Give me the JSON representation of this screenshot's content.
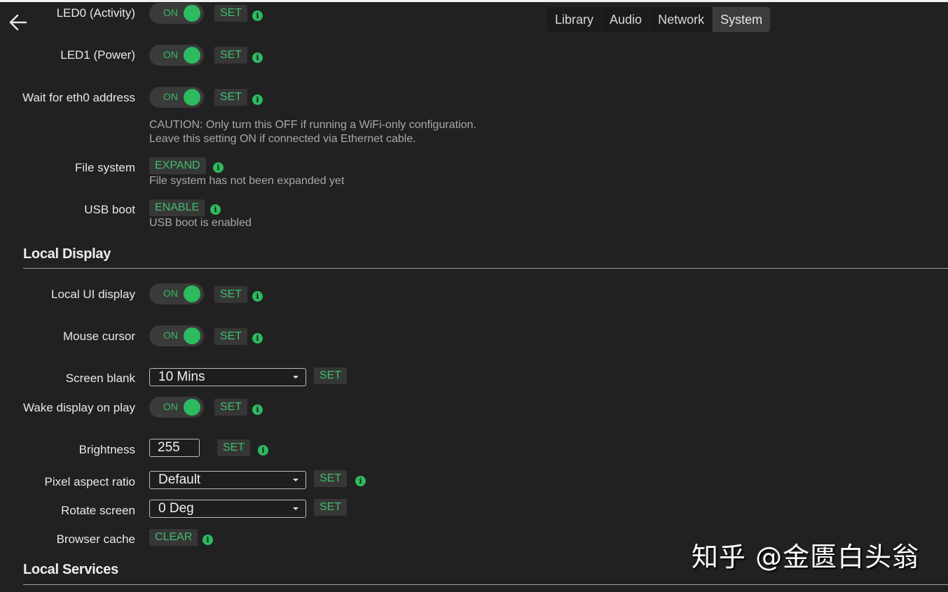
{
  "nav": {
    "back_icon": "arrow-left-icon",
    "tabs": [
      {
        "label": "Library",
        "active": false
      },
      {
        "label": "Audio",
        "active": false
      },
      {
        "label": "Network",
        "active": false
      },
      {
        "label": "System",
        "active": true
      }
    ]
  },
  "colors": {
    "background": "#212121",
    "accent": "#2dbb5f",
    "button_bg": "#363636",
    "toggle_bg": "#3a3a3a"
  },
  "system": {
    "led0": {
      "label": "LED0 (Activity)",
      "toggle": "ON",
      "button": "SET",
      "info_icon": "info-icon"
    },
    "led1": {
      "label": "LED1 (Power)",
      "toggle": "ON",
      "button": "SET"
    },
    "wait_eth0": {
      "label": "Wait for eth0 address",
      "toggle": "ON",
      "button": "SET",
      "help_line1": "CAUTION: Only turn this OFF if running a WiFi-only configuration.",
      "help_line2": "Leave this setting ON if connected via Ethernet cable."
    },
    "file_system": {
      "label": "File system",
      "button": "EXPAND",
      "help": "File system has not been expanded yet"
    },
    "usb_boot": {
      "label": "USB boot",
      "button": "ENABLE",
      "help": "USB boot is enabled"
    }
  },
  "local_display": {
    "title": "Local Display",
    "local_ui": {
      "label": "Local UI display",
      "toggle": "ON",
      "button": "SET"
    },
    "mouse_cursor": {
      "label": "Mouse cursor",
      "toggle": "ON",
      "button": "SET"
    },
    "screen_blank": {
      "label": "Screen blank",
      "value": "10 Mins",
      "button": "SET"
    },
    "wake_display": {
      "label": "Wake display on play",
      "toggle": "ON",
      "button": "SET"
    },
    "brightness": {
      "label": "Brightness",
      "value": "255",
      "button": "SET"
    },
    "pixel_aspect": {
      "label": "Pixel aspect ratio",
      "value": "Default",
      "button": "SET"
    },
    "rotate_screen": {
      "label": "Rotate screen",
      "value": "0 Deg",
      "button": "SET"
    },
    "browser_cache": {
      "label": "Browser cache",
      "button": "CLEAR"
    }
  },
  "local_services": {
    "title": "Local Services"
  },
  "info_glyph": "i",
  "watermark": "知乎 @金匮白头翁"
}
